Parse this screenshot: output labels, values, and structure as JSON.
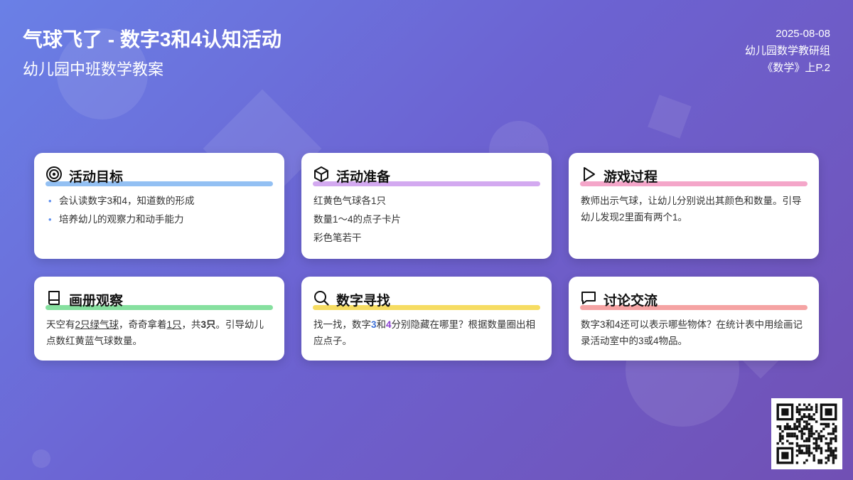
{
  "header": {
    "title": "气球飞了 - 数字3和4认知活动",
    "subtitle": "幼儿园中班数学教案"
  },
  "meta": {
    "date": "2025-08-08",
    "group": "幼儿园数学教研组",
    "ref": "《数学》上P.2"
  },
  "cards": {
    "goals": {
      "title": "活动目标",
      "icon": "target-icon",
      "bar_color": "#93c0f3",
      "items": [
        "会认读数字3和4，知道数的形成",
        "培养幼儿的观察力和动手能力"
      ]
    },
    "prep": {
      "title": "活动准备",
      "icon": "cube-icon",
      "bar_color": "#d3a9f0",
      "items": [
        "红黄色气球各1只",
        "数量1～4的点子卡片",
        "彩色笔若干"
      ]
    },
    "process": {
      "title": "游戏过程",
      "icon": "play-icon",
      "bar_color": "#f4a6c9",
      "text": "教师出示气球，让幼儿分别说出其颜色和数量。引导幼儿发现2里面有两个1。"
    },
    "observe": {
      "title": "画册观察",
      "icon": "book-icon",
      "bar_color": "#86e09f",
      "parts": [
        "天空有",
        "2只绿气球",
        "，奇奇拿着",
        "1只",
        "，共",
        "3只",
        "。引导幼儿点数红黄蓝气球数量。"
      ]
    },
    "find": {
      "title": "数字寻找",
      "icon": "search-icon",
      "bar_color": "#f6dc62",
      "parts": [
        "找一找，数字",
        "3",
        "和",
        "4",
        "分别隐藏在哪里？根据数量圈出相应点子。"
      ],
      "num3_color": "#3b6fd6",
      "num4_color": "#8a3fd1"
    },
    "discuss": {
      "title": "讨论交流",
      "icon": "chat-icon",
      "bar_color": "#f5a3a3",
      "text": "数字3和4还可以表示哪些物体？在统计表中用绘画记录活动室中的3或4物品。"
    }
  }
}
